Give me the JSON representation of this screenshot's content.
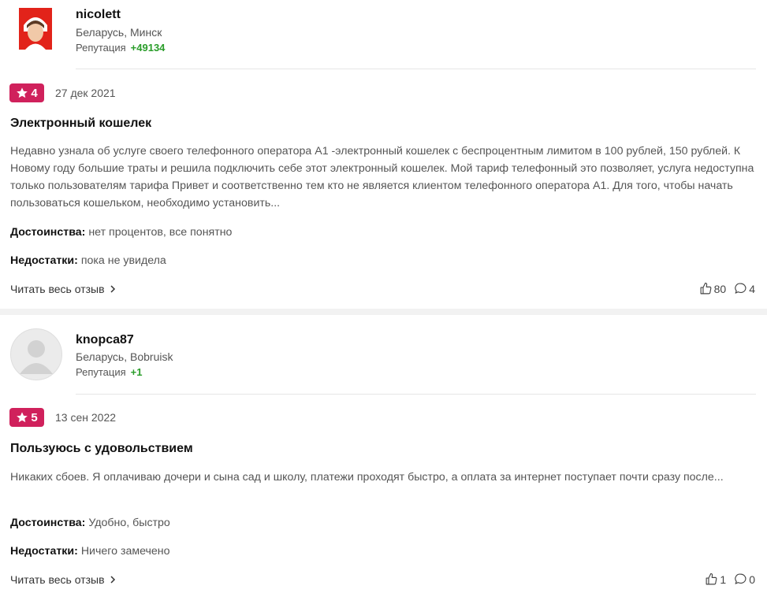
{
  "reviews": [
    {
      "username": "nicolett",
      "location": "Беларусь, Минск",
      "reputation_label": "Репутация",
      "reputation_value": "+49134",
      "rating": "4",
      "date": "27 дек 2021",
      "title": "Электронный кошелек",
      "text": "Недавно узнала об услуге своего телефонного оператора А1 -электронный кошелек с беспроцентным лимитом в 100 рублей, 150 рублей. К Новому году большие траты и решила подключить себе этот электронный кошелек. Мой тариф телефонный это позволяет, услуга недоступна только пользователям тарифа Привет и соответственно тем кто не является клиентом телефонного оператора А1. Для того, чтобы начать пользоваться кошельком, необходимо установить...",
      "pros_label": "Достоинства:",
      "pros": "нет процентов, все понятно",
      "cons_label": "Недостатки:",
      "cons": "пока не увидела",
      "read_more": "Читать весь отзыв",
      "likes": "80",
      "comments": "4"
    },
    {
      "username": "knopca87",
      "location": "Беларусь, Bobruisk",
      "reputation_label": "Репутация",
      "reputation_value": "+1",
      "rating": "5",
      "date": "13 сен 2022",
      "title": "Пользуюсь с удовольствием",
      "text": "Никаких сбоев. Я оплачиваю дочери и сына сад и школу, платежи проходят быстро, а оплата за интернет поступает почти сразу после...",
      "pros_label": "Достоинства:",
      "pros": "Удобно, быстро",
      "cons_label": "Недостатки:",
      "cons": "Ничего замечено",
      "read_more": "Читать весь отзыв",
      "likes": "1",
      "comments": "0"
    }
  ],
  "colors": {
    "rating_badge": "#d0215c",
    "reputation": "#2a9d2a"
  },
  "icons": [
    "star-icon",
    "chevron-right-icon",
    "thumb-up-icon",
    "comment-icon",
    "default-avatar-icon"
  ]
}
